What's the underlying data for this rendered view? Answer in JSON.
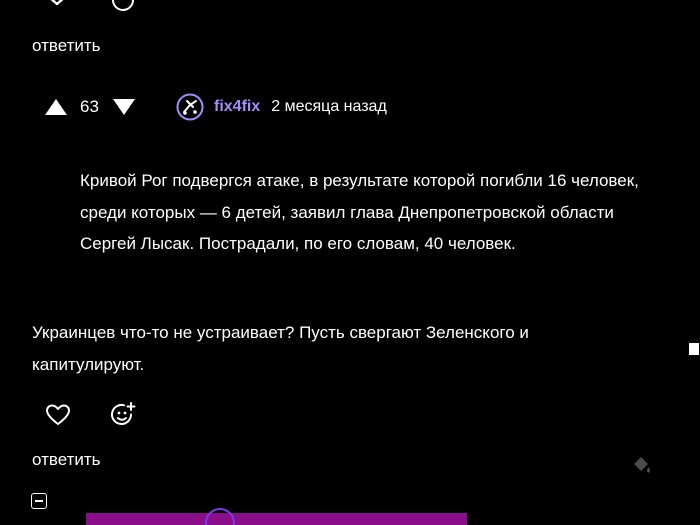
{
  "top": {
    "reply_label": "ответить"
  },
  "comment": {
    "vote_count": "63",
    "username": "fix4fix",
    "timestamp": "2 месяца назад",
    "quote": "Кривой Рог подвергся атаке, в результате которой погибли 16 человек, среди которых — 6 детей, заявил глава Днепропетровской области Сергей Лысак. Пострадали, по его словам, 40 человек.",
    "body": "Украинцев что-то не устраивает? Пусть свергают Зеленского и капитулируют.",
    "reply_label": "ответить"
  },
  "colors": {
    "background": "#000000",
    "username": "#a78bfa",
    "accent_bar": "#8a0e8a"
  }
}
